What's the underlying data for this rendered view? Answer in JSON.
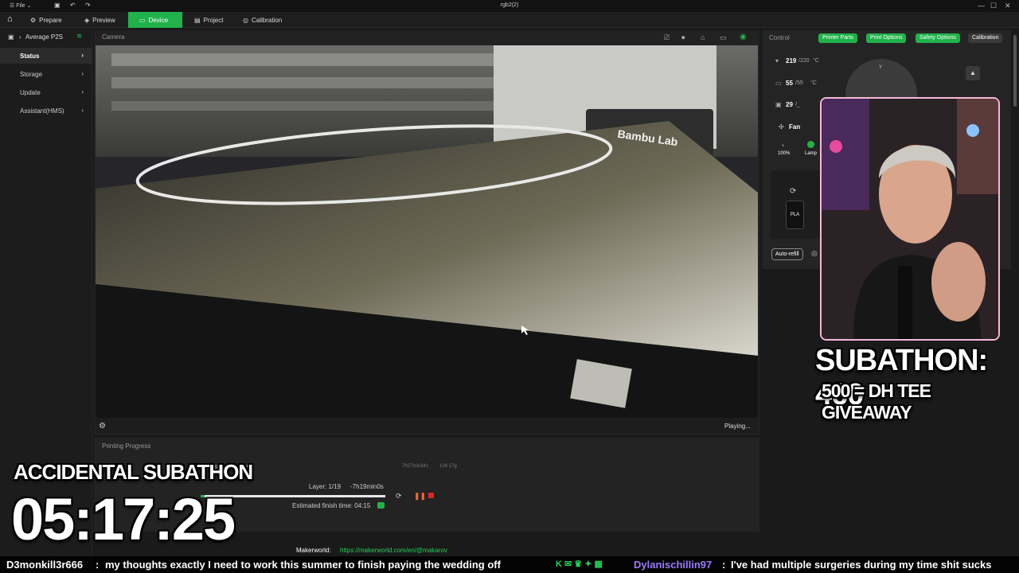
{
  "window": {
    "menu_label": "File",
    "title": "rgb2(2)"
  },
  "tabs": [
    {
      "label": "Prepare",
      "active": false
    },
    {
      "label": "Preview",
      "active": false
    },
    {
      "label": "Device",
      "active": true
    },
    {
      "label": "Project",
      "active": false
    },
    {
      "label": "Calibration",
      "active": false
    }
  ],
  "sidebar": {
    "printer_name": "Average P2S",
    "items": [
      {
        "label": "Status",
        "active": true
      },
      {
        "label": "Storage",
        "active": false
      },
      {
        "label": "Update",
        "active": false
      },
      {
        "label": "Assistant(HMS)",
        "active": false
      }
    ]
  },
  "camera": {
    "label": "Camera",
    "status": "Playing...",
    "brand_text": "Bambu Lab"
  },
  "progress": {
    "label": "Printing Progress",
    "model_info": "walls, 15% infill",
    "layer": "Layer: 1/19",
    "remaining": "-7h19min0s",
    "estimated_finish": "Estimated finish time: 04:15",
    "total_time": "7h27min34s",
    "weight": "104.17g",
    "progress_fraction": 0.02
  },
  "control": {
    "label": "Control",
    "buttons": [
      "Printer Parts",
      "Print Options",
      "Safety Options",
      "Calibration"
    ],
    "nozzle_temp": "219",
    "nozzle_target": "/220",
    "bed_temp": "55",
    "bed_target": "/55",
    "chamber_temp": "29",
    "chamber_target": "/_",
    "unit": "°C",
    "fan_label": "Fan",
    "fan_speed": "100%",
    "lamp_label": "Lamp",
    "filament": "PLA",
    "auto_refill": "Auto-refill"
  },
  "stream_overlay": {
    "subathon_count": "SUBATHON: 460",
    "giveaway": "500 = DH TEE GIVEAWAY",
    "accidental": "ACCIDENTAL SUBATHON",
    "timer": "05:17:25",
    "makerworld_label": "Makerworld:",
    "makerworld_url": "https://makerworld.com/en/@makarov"
  },
  "chat": [
    {
      "user": "D3monkill3r666",
      "message": "my thoughts exactly I need to work this summer to finish paying the wedding off",
      "user_color": "#ffffff"
    },
    {
      "user": "Dylanischillin97",
      "message": "I've had multiple surgeries during my time shit sucks",
      "user_color": "#9b7bff"
    }
  ],
  "colors": {
    "accent": "#21b34b",
    "stop": "#e02424"
  }
}
